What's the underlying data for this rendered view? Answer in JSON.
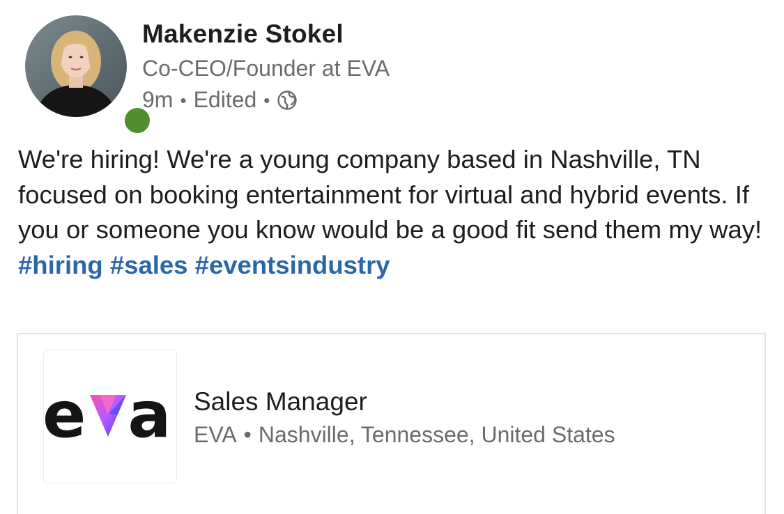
{
  "author": {
    "name": "Makenzie Stokel",
    "headline": "Co-CEO/Founder at EVA",
    "time": "9m",
    "edited": "Edited",
    "separator": "•",
    "visibility_icon": "globe-icon",
    "presence_color": "#4f8f2f"
  },
  "post": {
    "text": "We're hiring! We're a young company based in Nashville, TN focused on booking entertainment for virtual and hybrid events. If you or someone you know would be a good fit send them my way! ",
    "hashtags": [
      "#hiring",
      "#sales",
      "#eventsindustry"
    ],
    "hashtag_color": "#2a67a8"
  },
  "job": {
    "logo_text": "eva",
    "title": "Sales Manager",
    "company": "EVA",
    "separator": "•",
    "location": "Nashville, Tennessee, United States"
  }
}
